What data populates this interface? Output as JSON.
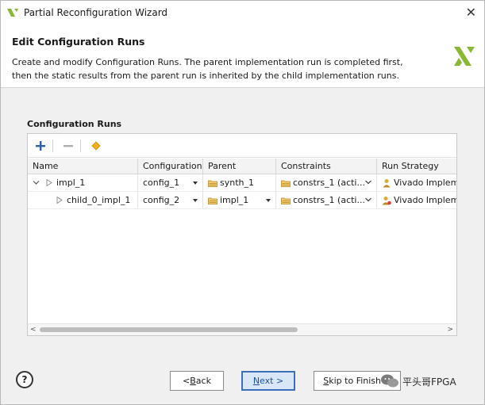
{
  "window": {
    "title": "Partial Reconfiguration Wizard"
  },
  "header": {
    "title": "Edit Configuration Runs",
    "description": "Create and modify Configuration Runs. The parent implementation run is completed first, then the static results from the parent run is inherited by the child implementation runs."
  },
  "section": {
    "label": "Configuration Runs"
  },
  "table": {
    "columns": [
      "Name",
      "Configuration",
      "Parent",
      "Constraints",
      "Run Strategy"
    ],
    "rows": [
      {
        "name": "impl_1",
        "configuration": "config_1",
        "parent": "synth_1",
        "constraints": "constrs_1 (acti...",
        "strategy": "Vivado Impleme"
      },
      {
        "name": "child_0_impl_1",
        "configuration": "config_2",
        "parent": "impl_1",
        "constraints": "constrs_1 (acti...",
        "strategy": "Vivado Impleme"
      }
    ]
  },
  "buttons": {
    "back": {
      "prefix": "< ",
      "mnemonic": "B",
      "rest": "ack"
    },
    "next": {
      "mnemonic": "N",
      "rest": "ext >"
    },
    "skip": {
      "mnemonic": "S",
      "rest": "kip to Finish >"
    },
    "help": "?"
  },
  "watermark": "平头哥FPGA",
  "colors": {
    "accent": "#3d6eb8",
    "logo": "#8bb833",
    "folder": "#d9a93a"
  }
}
